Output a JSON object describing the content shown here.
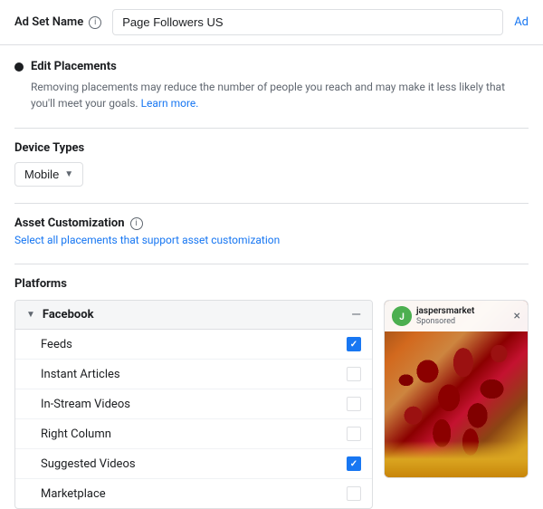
{
  "header": {
    "label": "Ad Set Name",
    "info_icon": "ⓘ",
    "input_value": "Page Followers US",
    "right_link": "Ad"
  },
  "edit_placements": {
    "title": "Edit Placements",
    "description": "Removing placements may reduce the number of people you reach and may make it less likely that you'll meet your goals.",
    "learn_more": "Learn more."
  },
  "device_types": {
    "title": "Device Types",
    "dropdown_label": "Mobile",
    "dropdown_arrow": "▼"
  },
  "asset_customization": {
    "title": "Asset Customization",
    "link_text": "Select all placements that support asset customization"
  },
  "platforms": {
    "title": "Platforms",
    "facebook": {
      "name": "Facebook",
      "expand_icon": "▼",
      "collapse_icon": "—",
      "placements": [
        {
          "label": "Feeds",
          "checked": true
        },
        {
          "label": "Instant Articles",
          "checked": false
        },
        {
          "label": "In-Stream Videos",
          "checked": false
        },
        {
          "label": "Right Column",
          "checked": false
        },
        {
          "label": "Suggested Videos",
          "checked": true
        },
        {
          "label": "Marketplace",
          "checked": false
        }
      ]
    }
  },
  "preview": {
    "username": "jaspersmarket",
    "sponsored": "Sponsored",
    "close_icon": "×"
  }
}
